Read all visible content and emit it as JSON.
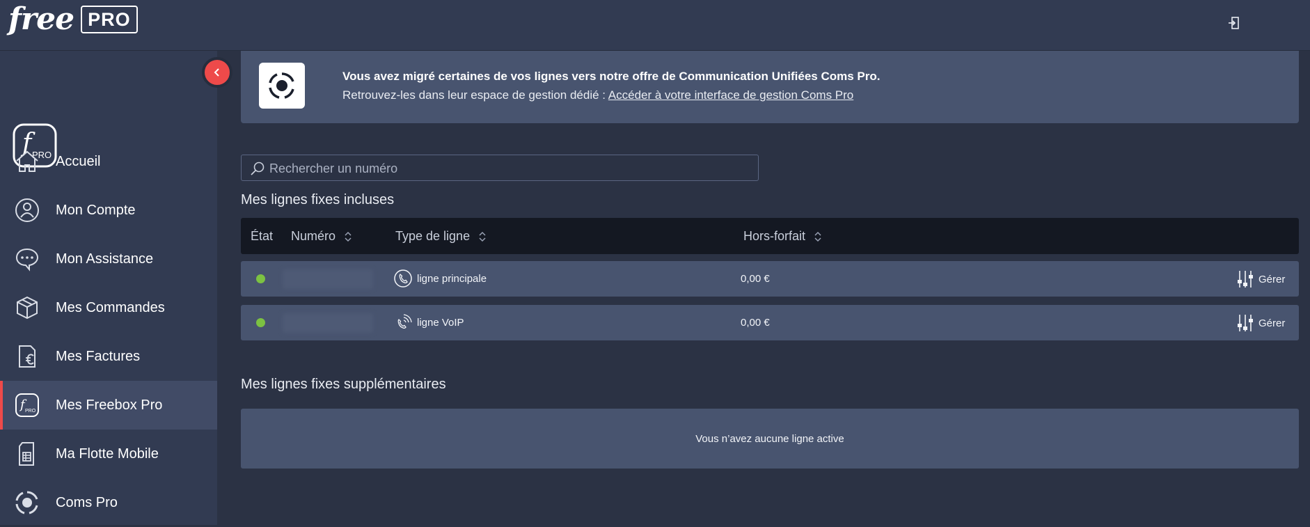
{
  "header": {
    "logo_text": "free",
    "logo_badge": "PRO",
    "logout_icon": "logout-icon"
  },
  "sidebar": {
    "badge_text": "PRO",
    "items": [
      {
        "label": "Accueil",
        "icon": "home-icon"
      },
      {
        "label": "Mon Compte",
        "icon": "user-icon"
      },
      {
        "label": "Mon Assistance",
        "icon": "chat-icon"
      },
      {
        "label": "Mes Commandes",
        "icon": "package-icon"
      },
      {
        "label": "Mes Factures",
        "icon": "invoice-euro-icon"
      },
      {
        "label": "Mes Freebox Pro",
        "icon": "freebox-pro-icon",
        "active": true
      },
      {
        "label": "Ma Flotte Mobile",
        "icon": "sim-card-icon"
      },
      {
        "label": "Coms Pro",
        "icon": "coms-pro-icon"
      }
    ]
  },
  "banner": {
    "title": "Vous avez migré certaines de vos lignes vers notre offre de Communication Unifiées Coms Pro.",
    "text": "Retrouvez-les dans leur espace de gestion dédié : ",
    "link": "Accéder à votre interface de gestion Coms Pro"
  },
  "search": {
    "placeholder": "Rechercher un numéro"
  },
  "included": {
    "title": "Mes lignes fixes incluses",
    "columns": {
      "state": "État",
      "number": "Numéro",
      "type": "Type de ligne",
      "overage": "Hors-forfait"
    },
    "rows": [
      {
        "status_color": "#7cc242",
        "type": "ligne principale",
        "type_icon": "phone-icon",
        "overage": "0,00 €",
        "action": "Gérer"
      },
      {
        "status_color": "#7cc242",
        "type": "ligne VoIP",
        "type_icon": "voip-phone-icon",
        "overage": "0,00 €",
        "action": "Gérer"
      }
    ]
  },
  "extra": {
    "title": "Mes lignes fixes supplémentaires",
    "empty_text": "Vous n’avez aucune ligne active"
  },
  "colors": {
    "accent": "#ee4a4a",
    "status_active": "#7cc242",
    "sidebar_bg": "#323b52",
    "main_bg": "#2b3244",
    "card_bg": "#48546f"
  }
}
